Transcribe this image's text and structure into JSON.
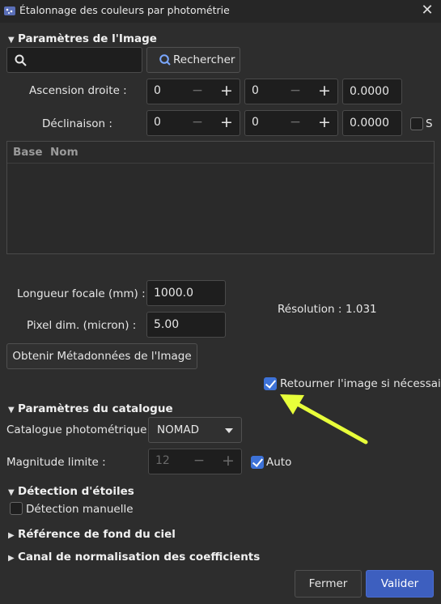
{
  "window": {
    "title": "Étalonnage des couleurs par photométrie",
    "close_icon": "close-icon"
  },
  "image_params": {
    "heading": "Paramètres de l'Image",
    "search_value": "",
    "search_button": "Rechercher",
    "ra_label": "Ascension droite :",
    "ra": [
      "0",
      "0",
      "0.0000"
    ],
    "dec_label": "Déclinaison :",
    "dec": [
      "0",
      "0",
      "0.0000"
    ],
    "south_label": "S",
    "table_columns": [
      "Base",
      "Nom"
    ],
    "focal_label": "Longueur focale (mm) :",
    "focal_value": "1000.0",
    "pixel_label": "Pixel dim. (micron) :",
    "pixel_value": "5.00",
    "resolution_label": "Résolution :",
    "resolution_value": "1.031",
    "metadata_button": "Obtenir Métadonnées de l'Image",
    "flip_label": "Retourner l'image si nécessaire",
    "flip_checked": true
  },
  "catalog_params": {
    "heading": "Paramètres du catalogue",
    "catalog_label": "Catalogue photométrique :",
    "catalog_value": "NOMAD",
    "magnitude_label": "Magnitude limite :",
    "magnitude_value": "12",
    "auto_label": "Auto",
    "auto_checked": true
  },
  "star_detection": {
    "heading": "Détection d'étoiles",
    "manual_label": "Détection manuelle",
    "manual_checked": false
  },
  "sky_background": {
    "heading": "Référence de fond du ciel"
  },
  "normalization": {
    "heading": "Canal de normalisation des coefficients"
  },
  "footer": {
    "cancel_label": "Fermer",
    "ok_label": "Valider"
  },
  "colors": {
    "accent": "#3d72d8",
    "annotation_arrow": "#e8ff3a"
  }
}
